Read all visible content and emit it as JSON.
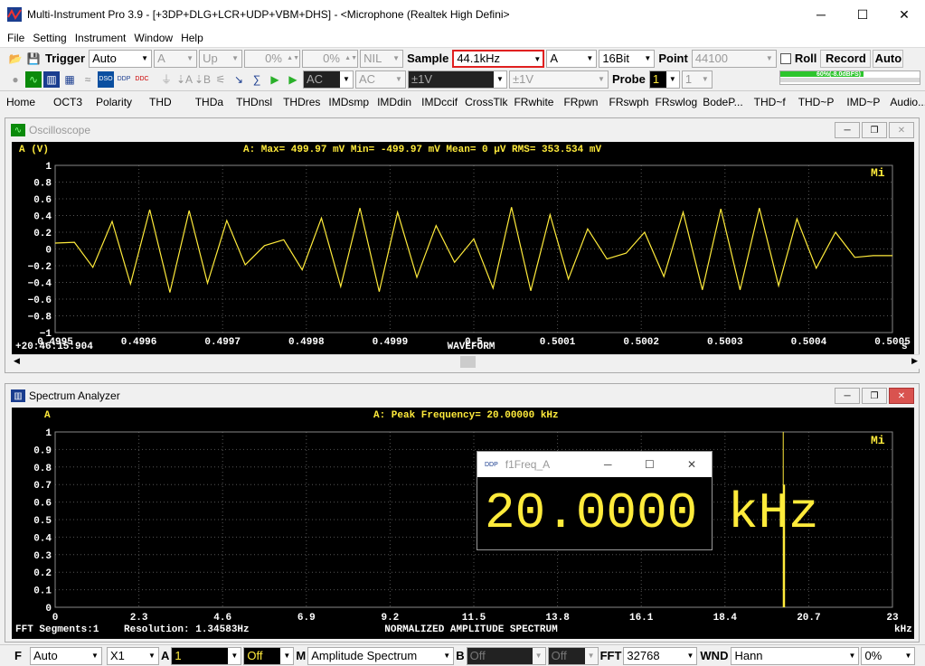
{
  "titlebar": {
    "title": "Multi-Instrument Pro 3.9   -   [+3DP+DLG+LCR+UDP+VBM+DHS]   -   <Microphone (Realtek High Defini>"
  },
  "menu": [
    "File",
    "Setting",
    "Instrument",
    "Window",
    "Help"
  ],
  "toolbar1": {
    "trigger_label": "Trigger",
    "trigger_mode": "Auto",
    "trigger_channel": "A",
    "trigger_edge": "Up",
    "level1": "0%",
    "level2": "0%",
    "nil": "NIL",
    "sample_label": "Sample",
    "sample_rate": "44.1kHz",
    "channel": "A",
    "bits": "16Bit",
    "point_label": "Point",
    "points": "44100",
    "roll_label": "Roll",
    "record_label": "Record",
    "auto_label": "Auto",
    "level_meter": "60%(-8.0dBFS)"
  },
  "toolbar2": {
    "coupling_a": "AC",
    "coupling_b": "AC",
    "range_a": "±1V",
    "range_b": "±1V",
    "probe_label": "Probe",
    "probe_a": "1",
    "probe_b": "1"
  },
  "tabs": [
    "Home",
    "OCT3",
    "Polarity",
    "THD",
    "THDa",
    "THDnsl",
    "THDres",
    "IMDsmp",
    "IMDdin",
    "IMDccif",
    "CrossTlk",
    "FRwhite",
    "FRpwn",
    "FRswph",
    "FRswlog",
    "BodeP...",
    "THD~f",
    "THD~P",
    "IMD~P",
    "Audio..."
  ],
  "oscilloscope": {
    "title": "Oscilloscope",
    "y_unit": "A (V)",
    "stats": "A: Max=  499.97 mV  Min= -499.97 mV  Mean=        0 μV  RMS=  353.534 mV",
    "timestamp": "+20:46:15:904",
    "xlabel": "WAVEFORM",
    "xunit": "s",
    "badge": "Mi"
  },
  "spectrum": {
    "title": "Spectrum Analyzer",
    "y_unit": "A",
    "stats": "A: Peak Frequency= 20.00000 kHz",
    "fft_segments": "FFT Segments:1",
    "resolution": "Resolution: 1.34583Hz",
    "xlabel": "NORMALIZED AMPLITUDE SPECTRUM",
    "xunit": "kHz",
    "badge": "Mi"
  },
  "freq_window": {
    "title": "f1Freq_A",
    "value": "20.0000 kHz"
  },
  "statusbar": {
    "f_label": "F",
    "f_mode": "Auto",
    "x_mult": "X1",
    "a_label": "A",
    "a_val": "1",
    "off1": "Off",
    "m_label": "M",
    "m_mode": "Amplitude Spectrum",
    "b_label": "B",
    "b_val": "Off",
    "off2": "Off",
    "fft_label": "FFT",
    "fft_size": "32768",
    "wnd_label": "WND",
    "window": "Hann",
    "pct": "0%"
  },
  "chart_data": [
    {
      "type": "line",
      "x_ticks": [
        "0.4995",
        "0.4996",
        "0.4997",
        "0.4998",
        "0.4999",
        "0.5",
        "0.5001",
        "0.5002",
        "0.5003",
        "0.5004",
        "0.5005"
      ],
      "y_ticks": [
        "1",
        "0.8",
        "0.6",
        "0.4",
        "0.2",
        "0",
        "−0.2",
        "−0.4",
        "−0.6",
        "−0.8",
        "−1"
      ],
      "xlim": [
        0.4995,
        0.5005
      ],
      "ylim": [
        -1,
        1
      ],
      "x": [
        0.4995,
        0.499523,
        0.499545,
        0.499568,
        0.49959,
        0.499613,
        0.499637,
        0.49966,
        0.499682,
        0.499705,
        0.499727,
        0.49975,
        0.499773,
        0.499795,
        0.499818,
        0.499841,
        0.499864,
        0.499887,
        0.499909,
        0.499932,
        0.499955,
        0.499977,
        0.5,
        0.500023,
        0.500045,
        0.500068,
        0.500091,
        0.500113,
        0.500136,
        0.500159,
        0.500182,
        0.500204,
        0.500227,
        0.50025,
        0.500273,
        0.500295,
        0.500318,
        0.500341,
        0.500364,
        0.500386,
        0.500409,
        0.500432,
        0.500455,
        0.500477,
        0.5005
      ],
      "y": [
        0.07,
        0.08,
        -0.22,
        0.33,
        -0.42,
        0.47,
        -0.52,
        0.46,
        -0.41,
        0.34,
        -0.19,
        0.04,
        0.11,
        -0.25,
        0.37,
        -0.45,
        0.49,
        -0.51,
        0.44,
        -0.34,
        0.28,
        -0.16,
        0.12,
        -0.47,
        0.5,
        -0.5,
        0.41,
        -0.36,
        0.24,
        -0.12,
        -0.05,
        0.2,
        -0.33,
        0.44,
        -0.49,
        0.48,
        -0.49,
        0.49,
        -0.44,
        0.36,
        -0.23,
        0.2,
        -0.1,
        -0.08,
        -0.08
      ]
    },
    {
      "type": "bar",
      "x_ticks": [
        "0",
        "2.3",
        "4.6",
        "6.9",
        "9.2",
        "11.5",
        "13.8",
        "16.1",
        "18.4",
        "20.7",
        "23"
      ],
      "y_ticks": [
        "1",
        "0.9",
        "0.8",
        "0.7",
        "0.6",
        "0.5",
        "0.4",
        "0.3",
        "0.2",
        "0.1",
        "0"
      ],
      "xlim": [
        0,
        23
      ],
      "ylim": [
        0,
        1
      ],
      "peak_x": 20.0,
      "peak_y": 1.0,
      "second_x": 20.0,
      "second_y": 0.7
    }
  ]
}
